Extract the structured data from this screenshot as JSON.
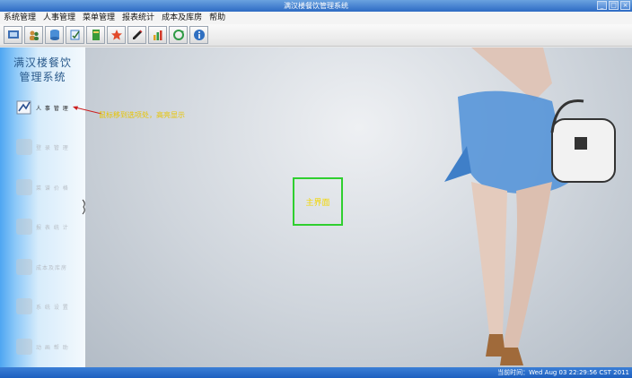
{
  "window": {
    "title": "满汉楼餐饮管理系统",
    "buttons": [
      "_",
      "□",
      "×"
    ]
  },
  "menubar": {
    "items": [
      "系统管理",
      "人事管理",
      "菜单管理",
      "报表统计",
      "成本及库房",
      "帮助"
    ]
  },
  "toolbar": {
    "buttons": [
      {
        "icon": "display-icon",
        "color": "#3d6fb5"
      },
      {
        "icon": "users-icon",
        "color": "#c88b3a"
      },
      {
        "icon": "database-icon",
        "color": "#4a8ed6"
      },
      {
        "icon": "check-edit-icon",
        "color": "#3b7cc9"
      },
      {
        "icon": "book-icon",
        "color": "#3a9b3a"
      },
      {
        "icon": "star-icon",
        "color": "#e24a2a"
      },
      {
        "icon": "pen-icon",
        "color": "#222222"
      },
      {
        "icon": "chart-icon",
        "color": "#e0a020"
      },
      {
        "icon": "recycle-icon",
        "color": "#2f9a45"
      },
      {
        "icon": "info-icon",
        "color": "#2f6fc1"
      }
    ]
  },
  "sidebar": {
    "title_line1": "满汉楼餐饮",
    "title_line2": "管理系统",
    "items": [
      {
        "label": "人 事 管 理",
        "active": true
      },
      {
        "label": "登 录 管 理",
        "active": false
      },
      {
        "label": "菜 谱 价 格",
        "active": false
      },
      {
        "label": "报 表 统 计",
        "active": false
      },
      {
        "label": "成本及库房",
        "active": false
      },
      {
        "label": "系 统 设 置",
        "active": false
      },
      {
        "label": "动 画 帮 助",
        "active": false
      }
    ]
  },
  "main": {
    "annotation": "鼠标移到选项处，高亮显示",
    "highlight_label": "主界面"
  },
  "statusbar": {
    "text": "当前时间：Wed Aug 03 22:29:56 CST 2011"
  },
  "colors": {
    "annotation": "#e8c400",
    "highlight_border": "#2fcf2f",
    "statusbar": "#2a6fcb"
  }
}
